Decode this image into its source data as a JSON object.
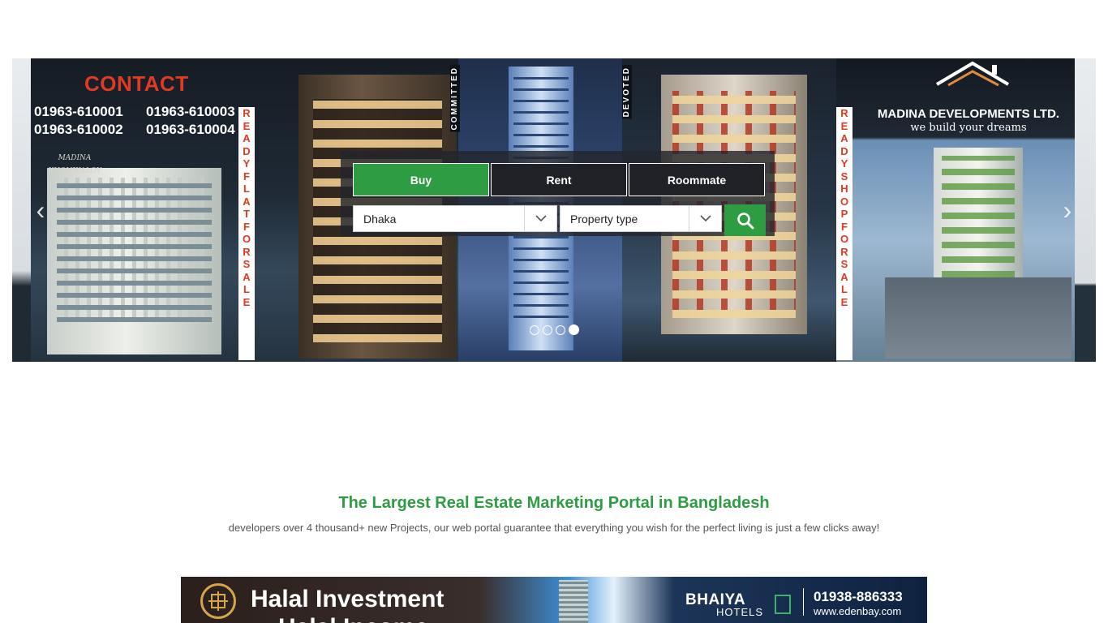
{
  "slider": {
    "contact_title": "CONTACT",
    "phones": [
      "01963-610001",
      "01963-610003",
      "01963-610002",
      "01963-610004"
    ],
    "project_name": "MADINA KHONIKALOY",
    "ribbon_left": [
      "R",
      "E",
      "A",
      "D",
      "Y",
      "F",
      "L",
      "A",
      "T",
      "F",
      "O",
      "R",
      "S",
      "A",
      "L",
      "E"
    ],
    "ribbon_right": [
      "R",
      "E",
      "A",
      "D",
      "Y",
      "S",
      "H",
      "O",
      "P",
      "F",
      "O",
      "R",
      "S",
      "A",
      "L",
      "E"
    ],
    "vertical_left": "COMMITTED",
    "vertical_right": "DEVOTED",
    "company": "MADINA DEVELOPMENTS LTD.",
    "tagline": "we build your dreams",
    "prev_arrow": "‹",
    "next_arrow": "›",
    "slide_count": 4,
    "active_slide": 4
  },
  "search": {
    "tabs": [
      {
        "label": "Buy",
        "active": true
      },
      {
        "label": "Rent",
        "active": false
      },
      {
        "label": "Roommate",
        "active": false
      }
    ],
    "city_value": "Dhaka",
    "type_placeholder": "Property type",
    "caret": "⌄"
  },
  "intro": {
    "heading": "The Largest Real Estate Marketing Portal in Bangladesh",
    "subtext": "developers over 4 thousand+ new Projects, our web portal guarantee that everything you wish for the perfect living is just a few clicks away!"
  },
  "banner": {
    "title": "Halal Investment",
    "title_line2": "Halal Income",
    "brand": "BHAIYA",
    "brand_sub": "HOTELS",
    "phone": "01938-886333",
    "website": "www.edenbay.com"
  },
  "colors": {
    "accent_green": "#2e9c42",
    "contact_red": "#e03a21"
  }
}
